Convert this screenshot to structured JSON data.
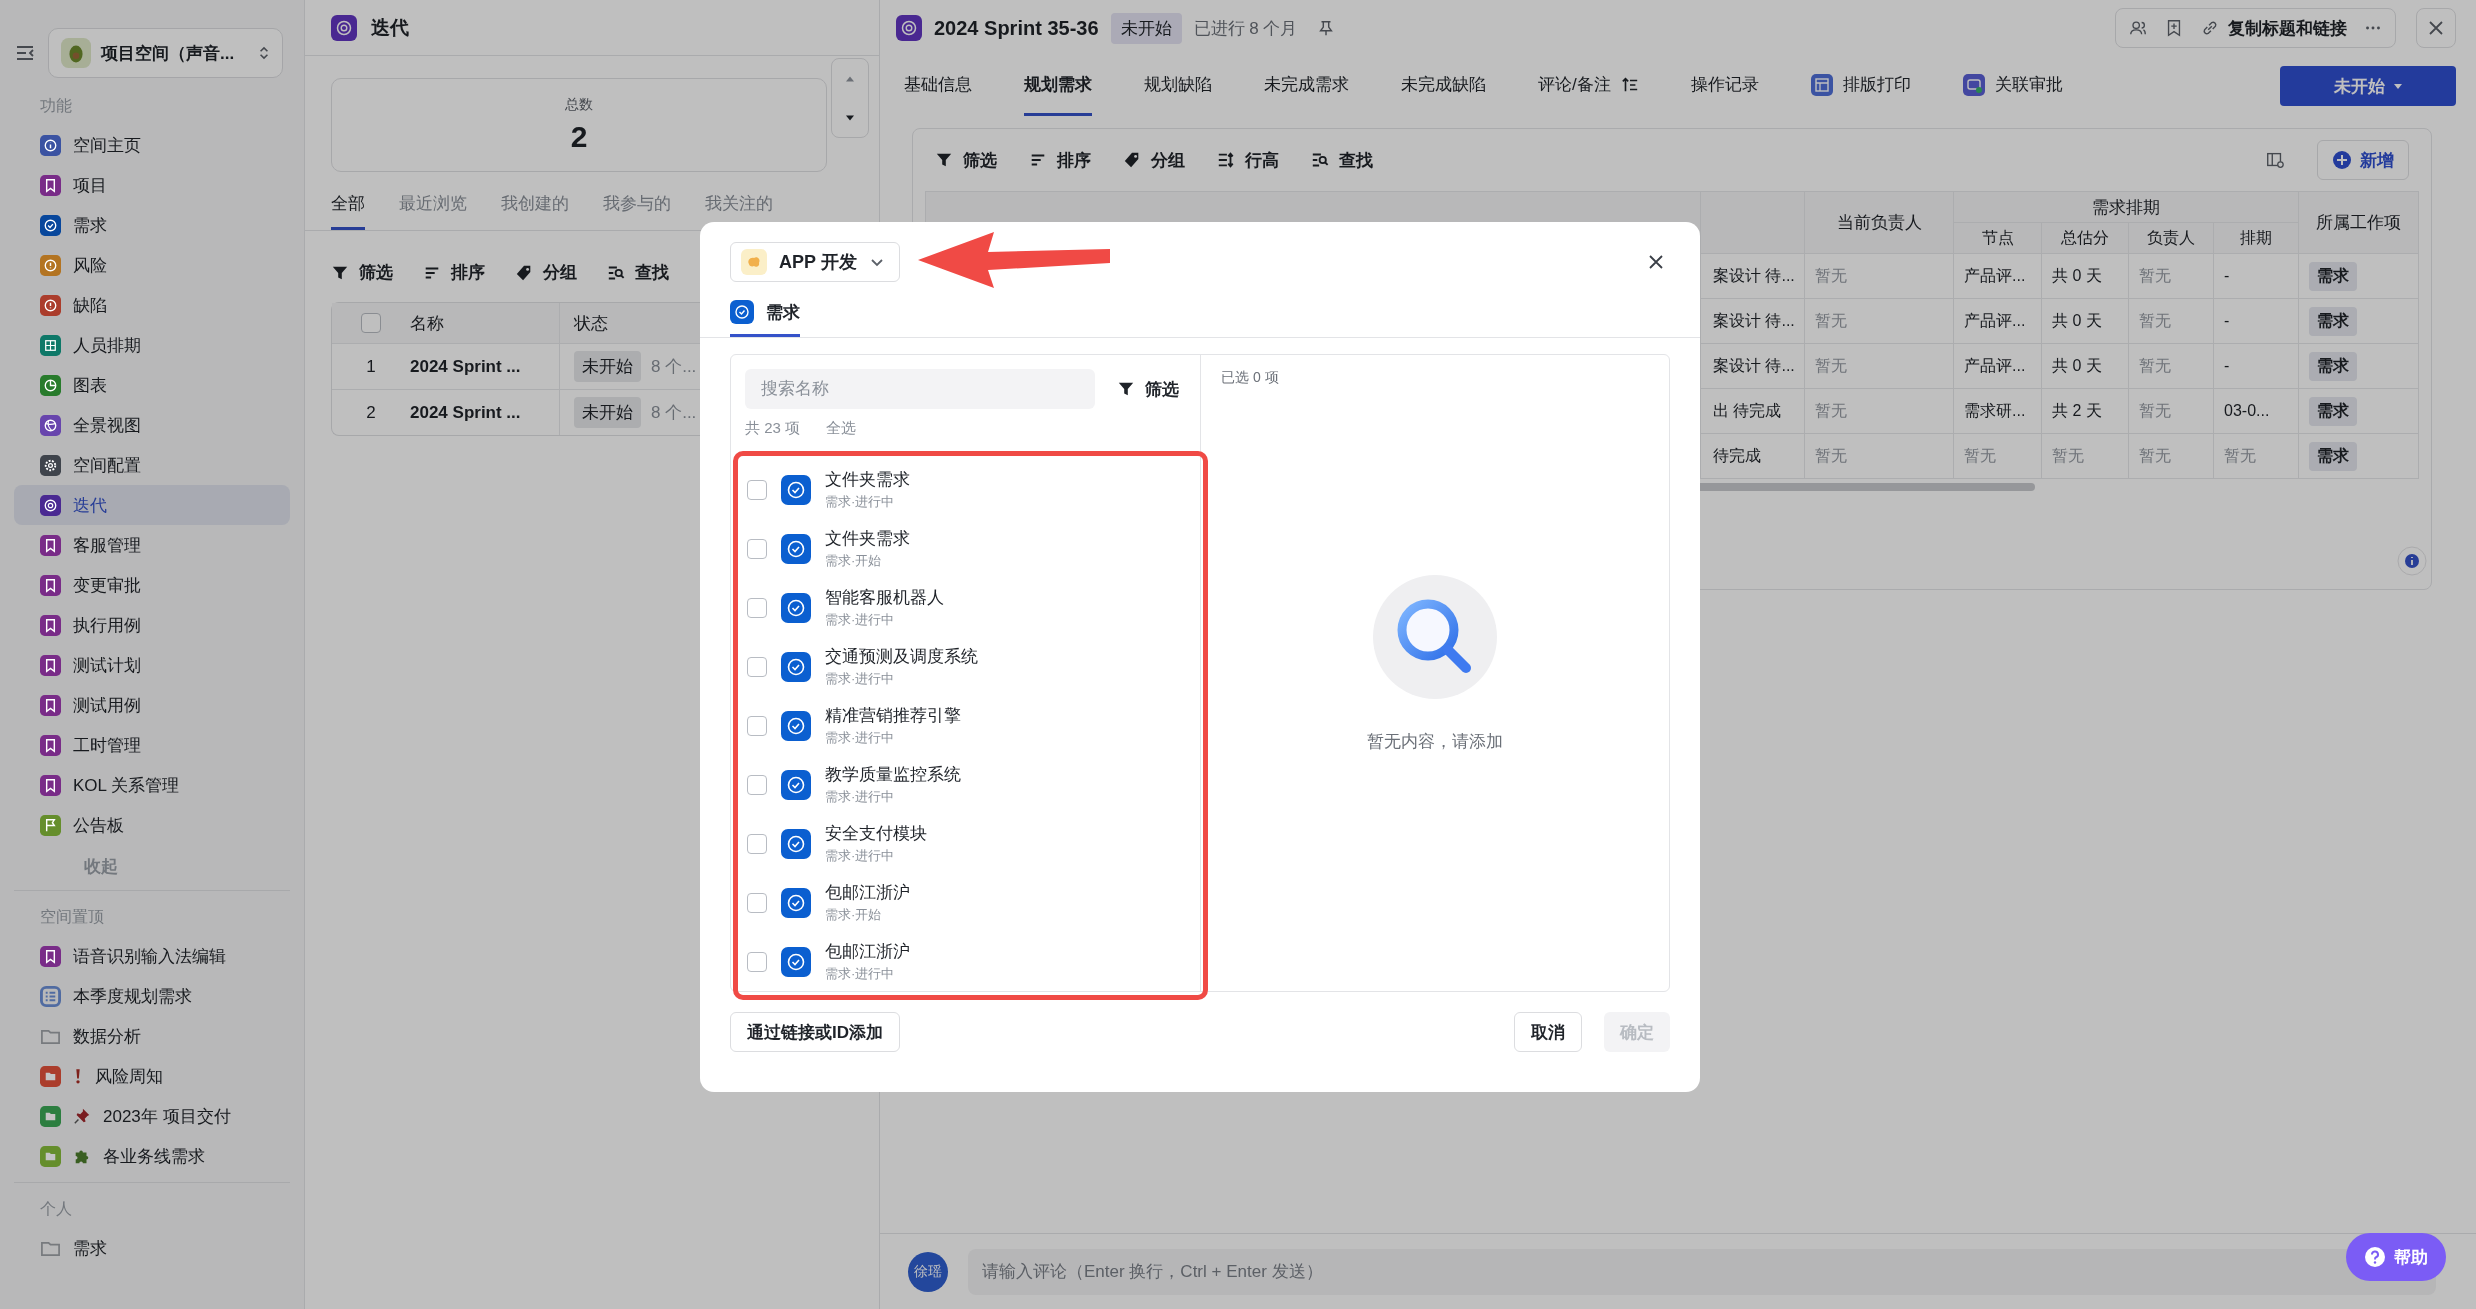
{
  "sidebar": {
    "space": {
      "name": "项目空间（声音..."
    },
    "sections": [
      {
        "title": "功能",
        "collapse": "收起",
        "items": [
          {
            "label": "空间主页",
            "kind": "info",
            "color": "#3b53a2",
            "selected": false
          },
          {
            "label": "项目",
            "kind": "bookmark",
            "color": "#792c88",
            "selected": false
          },
          {
            "label": "需求",
            "kind": "check",
            "color": "#08479c",
            "selected": false
          },
          {
            "label": "风险",
            "kind": "alert",
            "color": "#b37422",
            "selected": false
          },
          {
            "label": "缺陷",
            "kind": "alert",
            "color": "#ab3d2c",
            "selected": false
          },
          {
            "label": "人员排期",
            "kind": "grid",
            "color": "#0e7868",
            "selected": false
          },
          {
            "label": "图表",
            "kind": "pie",
            "color": "#287b2c",
            "selected": false
          },
          {
            "label": "全景视图",
            "kind": "globe",
            "color": "#6845ad",
            "selected": false
          },
          {
            "label": "空间配置",
            "kind": "gear",
            "color": "#3f444c",
            "selected": false
          },
          {
            "label": "迭代",
            "kind": "cycle",
            "color": "#4a2992",
            "selected": true
          },
          {
            "label": "客服管理",
            "kind": "bookmark",
            "color": "#792c88",
            "selected": false
          },
          {
            "label": "变更审批",
            "kind": "bookmark",
            "color": "#792c88",
            "selected": false
          },
          {
            "label": "执行用例",
            "kind": "bookmark",
            "color": "#792c88",
            "selected": false
          },
          {
            "label": "测试计划",
            "kind": "bookmark",
            "color": "#792c88",
            "selected": false
          },
          {
            "label": "测试用例",
            "kind": "bookmark",
            "color": "#792c88",
            "selected": false
          },
          {
            "label": "工时管理",
            "kind": "bookmark",
            "color": "#792c88",
            "selected": false
          },
          {
            "label": "KOL 关系管理",
            "kind": "bookmark",
            "color": "#792c88",
            "selected": false
          },
          {
            "label": "公告板",
            "kind": "flag",
            "color": "#658e2c",
            "selected": false
          }
        ]
      },
      {
        "title": "空间置顶",
        "items": [
          {
            "label": "语音识别输入法编辑",
            "kind": "bookmark",
            "color": "#792c88",
            "selected": false
          },
          {
            "label": "本季度规划需求",
            "kind": "list",
            "color": "#506ba1",
            "selected": false
          },
          {
            "label": "数据分析",
            "kind": "folder",
            "color": "#777a7e",
            "selected": false
          },
          {
            "label": "风险周知",
            "kind": "folder-alert",
            "color": "#ab3d2c",
            "selected": false
          },
          {
            "label": "2023年 项目交付",
            "kind": "folder-pin",
            "color": "#2c7e40",
            "selected": false
          },
          {
            "label": "各业务线需求",
            "kind": "folder-puzzle",
            "color": "#658e2c",
            "selected": false
          }
        ]
      },
      {
        "title": "个人",
        "items": [
          {
            "label": "需求",
            "kind": "folder",
            "color": "#777a7e",
            "selected": false
          }
        ]
      }
    ]
  },
  "iterations": {
    "title": "迭代",
    "total": {
      "label": "总数",
      "value": "2"
    },
    "tabs": [
      {
        "label": "全部",
        "selected": true
      },
      {
        "label": "最近浏览",
        "selected": false
      },
      {
        "label": "我创建的",
        "selected": false
      },
      {
        "label": "我参与的",
        "selected": false
      },
      {
        "label": "我关注的",
        "selected": false
      }
    ],
    "toolbar": [
      {
        "label": "筛选",
        "kind": "filter"
      },
      {
        "label": "排序",
        "kind": "sort"
      },
      {
        "label": "分组",
        "kind": "tag"
      },
      {
        "label": "查找",
        "kind": "find"
      }
    ],
    "table": {
      "all_checked": false,
      "columns": [
        "名称",
        "状态"
      ],
      "rows": [
        {
          "index": "1",
          "name": "2024 Sprint ...",
          "status": "未开始",
          "column_3": "8 个..."
        },
        {
          "index": "2",
          "name": "2024 Sprint ...",
          "status": "未开始",
          "column_3": "8 个..."
        }
      ]
    }
  },
  "detail": {
    "title": "2024 Sprint 35-36",
    "status": "未开始",
    "elapsed": "已进行 8 个月",
    "copy_link": "复制标题和链接",
    "tabs": [
      {
        "label": "基础信息",
        "kind": "plain",
        "selected": false
      },
      {
        "label": "规划需求",
        "kind": "plain",
        "selected": true
      },
      {
        "label": "规划缺陷",
        "kind": "plain",
        "selected": false
      },
      {
        "label": "未完成需求",
        "kind": "plain",
        "selected": false
      },
      {
        "label": "未完成缺陷",
        "kind": "plain",
        "selected": false
      },
      {
        "label": "评论/备注",
        "kind": "sort",
        "selected": false
      },
      {
        "label": "操作记录",
        "kind": "plain",
        "selected": false
      },
      {
        "label": "排版打印",
        "kind": "print",
        "selected": false
      },
      {
        "label": "关联审批",
        "kind": "approval",
        "selected": false
      }
    ],
    "status_button": "未开始",
    "toolbar": [
      {
        "label": "筛选",
        "kind": "filter"
      },
      {
        "label": "排序",
        "kind": "sort"
      },
      {
        "label": "分组",
        "kind": "tag"
      },
      {
        "label": "行高",
        "kind": "rowheight"
      },
      {
        "label": "查找",
        "kind": "find"
      }
    ],
    "add_button": "新增",
    "table": {
      "group_header": "需求排期",
      "columns": [
        "当前负责人",
        "节点",
        "总估分",
        "负责人",
        "排期",
        "所属工作项"
      ],
      "rows": [
        {
          "column_1": "案设计 待...",
          "cells": [
            {
              "text": "暂无",
              "muted": true
            },
            {
              "text": "产品评...",
              "muted": false
            },
            {
              "text": "共 0 天",
              "muted": false
            },
            {
              "text": "暂无",
              "muted": true
            },
            {
              "text": "-",
              "muted": false
            },
            {
              "text": "需求",
              "muted": false
            }
          ]
        },
        {
          "column_1": "案设计 待...",
          "cells": [
            {
              "text": "暂无",
              "muted": true
            },
            {
              "text": "产品评...",
              "muted": false
            },
            {
              "text": "共 0 天",
              "muted": false
            },
            {
              "text": "暂无",
              "muted": true
            },
            {
              "text": "-",
              "muted": false
            },
            {
              "text": "需求",
              "muted": false
            }
          ]
        },
        {
          "column_1": "案设计 待...",
          "cells": [
            {
              "text": "暂无",
              "muted": true
            },
            {
              "text": "产品评...",
              "muted": false
            },
            {
              "text": "共 0 天",
              "muted": false
            },
            {
              "text": "暂无",
              "muted": true
            },
            {
              "text": "-",
              "muted": false
            },
            {
              "text": "需求",
              "muted": false
            }
          ]
        },
        {
          "column_1": "出 待完成",
          "cells": [
            {
              "text": "暂无",
              "muted": true
            },
            {
              "text": "需求研...",
              "muted": false
            },
            {
              "text": "共 2 天",
              "muted": false
            },
            {
              "text": "暂无",
              "muted": true
            },
            {
              "text": "03-0...",
              "muted": false
            },
            {
              "text": "需求",
              "muted": false
            }
          ]
        },
        {
          "column_1": "待完成",
          "cells": [
            {
              "text": "暂无",
              "muted": true
            },
            {
              "text": "暂无",
              "muted": true
            },
            {
              "text": "暂无",
              "muted": true
            },
            {
              "text": "暂无",
              "muted": true
            },
            {
              "text": "暂无",
              "muted": true
            },
            {
              "text": "需求",
              "muted": false
            }
          ]
        }
      ]
    },
    "comment": {
      "avatar": "徐瑶",
      "placeholder": "请输入评论（Enter 换行，Ctrl + Enter 发送）"
    }
  },
  "help": "帮助",
  "modal": {
    "space": "APP 开发",
    "tabs": [
      {
        "label": "需求",
        "selected": true
      }
    ],
    "search": {
      "placeholder": "搜索名称"
    },
    "filter": "筛选",
    "count": "共 23 项",
    "select_all": "全选",
    "items": [
      {
        "title": "文件夹需求",
        "subtitle": "需求·进行中",
        "checked": false
      },
      {
        "title": "文件夹需求",
        "subtitle": "需求·开始",
        "checked": false
      },
      {
        "title": "智能客服机器人",
        "subtitle": "需求·进行中",
        "checked": false
      },
      {
        "title": "交通预测及调度系统",
        "subtitle": "需求·进行中",
        "checked": false
      },
      {
        "title": "精准营销推荐引擎",
        "subtitle": "需求·进行中",
        "checked": false
      },
      {
        "title": "教学质量监控系统",
        "subtitle": "需求·进行中",
        "checked": false
      },
      {
        "title": "安全支付模块",
        "subtitle": "需求·进行中",
        "checked": false
      },
      {
        "title": "包邮江浙沪",
        "subtitle": "需求·开始",
        "checked": false
      },
      {
        "title": "包邮江浙沪",
        "subtitle": "需求·进行中",
        "checked": false
      }
    ],
    "selected_count": "已选 0 项",
    "empty": "暂无内容，请添加",
    "link_add": "通过链接或ID添加",
    "cancel": "取消",
    "confirm": {
      "label": "确定",
      "disabled": true
    }
  },
  "annotations": {
    "arrow": true,
    "highlight_frame": true
  }
}
